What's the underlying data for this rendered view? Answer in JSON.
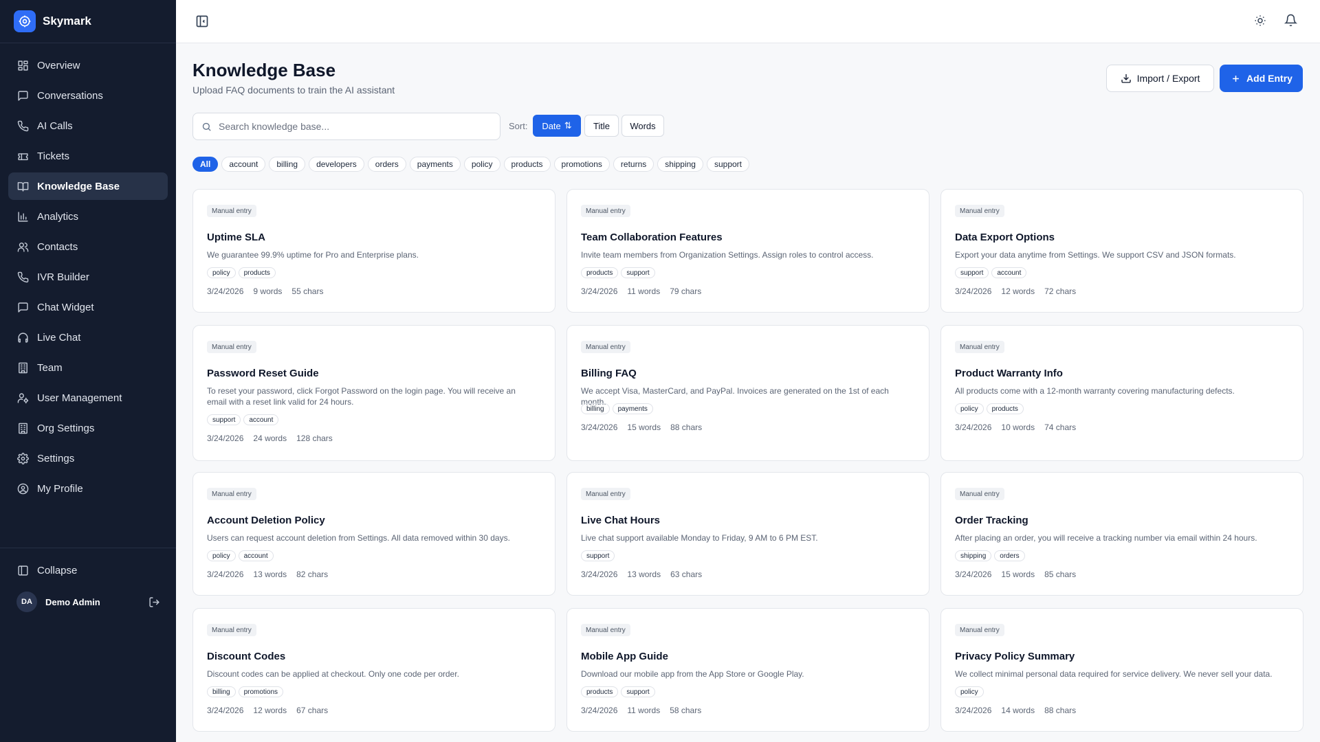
{
  "app": {
    "name": "Skymark"
  },
  "sidebar": {
    "items": [
      {
        "label": "Overview",
        "icon": "grid-icon",
        "active": false
      },
      {
        "label": "Conversations",
        "icon": "message-square-icon",
        "active": false
      },
      {
        "label": "AI Calls",
        "icon": "phone-icon",
        "active": false
      },
      {
        "label": "Tickets",
        "icon": "ticket-icon",
        "active": false
      },
      {
        "label": "Knowledge Base",
        "icon": "book-open-icon",
        "active": true
      },
      {
        "label": "Analytics",
        "icon": "bar-chart-icon",
        "active": false
      },
      {
        "label": "Contacts",
        "icon": "users-icon",
        "active": false
      },
      {
        "label": "IVR Builder",
        "icon": "phone-icon",
        "active": false
      },
      {
        "label": "Chat Widget",
        "icon": "message-square-icon",
        "active": false
      },
      {
        "label": "Live Chat",
        "icon": "headphones-icon",
        "active": false
      },
      {
        "label": "Team",
        "icon": "building-icon",
        "active": false
      },
      {
        "label": "User Management",
        "icon": "user-cog-icon",
        "active": false
      },
      {
        "label": "Org Settings",
        "icon": "building-icon",
        "active": false
      },
      {
        "label": "Settings",
        "icon": "gear-icon",
        "active": false
      },
      {
        "label": "My Profile",
        "icon": "user-circle-icon",
        "active": false
      }
    ],
    "collapse_label": "Collapse",
    "user": {
      "initials": "DA",
      "name": "Demo Admin"
    }
  },
  "page": {
    "title": "Knowledge Base",
    "subtitle": "Upload FAQ documents to train the AI assistant",
    "import_export_label": "Import / Export",
    "add_entry_label": "Add Entry",
    "search_placeholder": "Search knowledge base...",
    "sort_label": "Sort:",
    "sort_options": [
      "Date",
      "Title",
      "Words"
    ],
    "sort_selected": "Date",
    "categories": [
      "All",
      "account",
      "billing",
      "developers",
      "orders",
      "payments",
      "policy",
      "products",
      "promotions",
      "returns",
      "shipping",
      "support"
    ],
    "category_selected": "All"
  },
  "entries": [
    {
      "badge": "Manual entry",
      "title": "Uptime SLA",
      "description": "We guarantee 99.9% uptime for Pro and Enterprise plans.",
      "tags": [
        "policy",
        "products"
      ],
      "date": "3/24/2026",
      "words": "9 words",
      "chars": "55 chars"
    },
    {
      "badge": "Manual entry",
      "title": "Team Collaboration Features",
      "description": "Invite team members from Organization Settings. Assign roles to control access.",
      "tags": [
        "products",
        "support"
      ],
      "date": "3/24/2026",
      "words": "11 words",
      "chars": "79 chars"
    },
    {
      "badge": "Manual entry",
      "title": "Data Export Options",
      "description": "Export your data anytime from Settings. We support CSV and JSON formats.",
      "tags": [
        "support",
        "account"
      ],
      "date": "3/24/2026",
      "words": "12 words",
      "chars": "72 chars"
    },
    {
      "badge": "Manual entry",
      "title": "Password Reset Guide",
      "description": "To reset your password, click Forgot Password on the login page. You will receive an email with a reset link valid for 24 hours.",
      "tags": [
        "support",
        "account"
      ],
      "date": "3/24/2026",
      "words": "24 words",
      "chars": "128 chars"
    },
    {
      "badge": "Manual entry",
      "title": "Billing FAQ",
      "description": "We accept Visa, MasterCard, and PayPal. Invoices are generated on the 1st of each month.",
      "tags": [
        "billing",
        "payments"
      ],
      "date": "3/24/2026",
      "words": "15 words",
      "chars": "88 chars"
    },
    {
      "badge": "Manual entry",
      "title": "Product Warranty Info",
      "description": "All products come with a 12-month warranty covering manufacturing defects.",
      "tags": [
        "policy",
        "products"
      ],
      "date": "3/24/2026",
      "words": "10 words",
      "chars": "74 chars"
    },
    {
      "badge": "Manual entry",
      "title": "Account Deletion Policy",
      "description": "Users can request account deletion from Settings. All data removed within 30 days.",
      "tags": [
        "policy",
        "account"
      ],
      "date": "3/24/2026",
      "words": "13 words",
      "chars": "82 chars"
    },
    {
      "badge": "Manual entry",
      "title": "Live Chat Hours",
      "description": "Live chat support available Monday to Friday, 9 AM to 6 PM EST.",
      "tags": [
        "support"
      ],
      "date": "3/24/2026",
      "words": "13 words",
      "chars": "63 chars"
    },
    {
      "badge": "Manual entry",
      "title": "Order Tracking",
      "description": "After placing an order, you will receive a tracking number via email within 24 hours.",
      "tags": [
        "shipping",
        "orders"
      ],
      "date": "3/24/2026",
      "words": "15 words",
      "chars": "85 chars"
    },
    {
      "badge": "Manual entry",
      "title": "Discount Codes",
      "description": "Discount codes can be applied at checkout. Only one code per order.",
      "tags": [
        "billing",
        "promotions"
      ],
      "date": "3/24/2026",
      "words": "12 words",
      "chars": "67 chars"
    },
    {
      "badge": "Manual entry",
      "title": "Mobile App Guide",
      "description": "Download our mobile app from the App Store or Google Play.",
      "tags": [
        "products",
        "support"
      ],
      "date": "3/24/2026",
      "words": "11 words",
      "chars": "58 chars"
    },
    {
      "badge": "Manual entry",
      "title": "Privacy Policy Summary",
      "description": "We collect minimal personal data required for service delivery. We never sell your data.",
      "tags": [
        "policy"
      ],
      "date": "3/24/2026",
      "words": "14 words",
      "chars": "88 chars"
    }
  ]
}
